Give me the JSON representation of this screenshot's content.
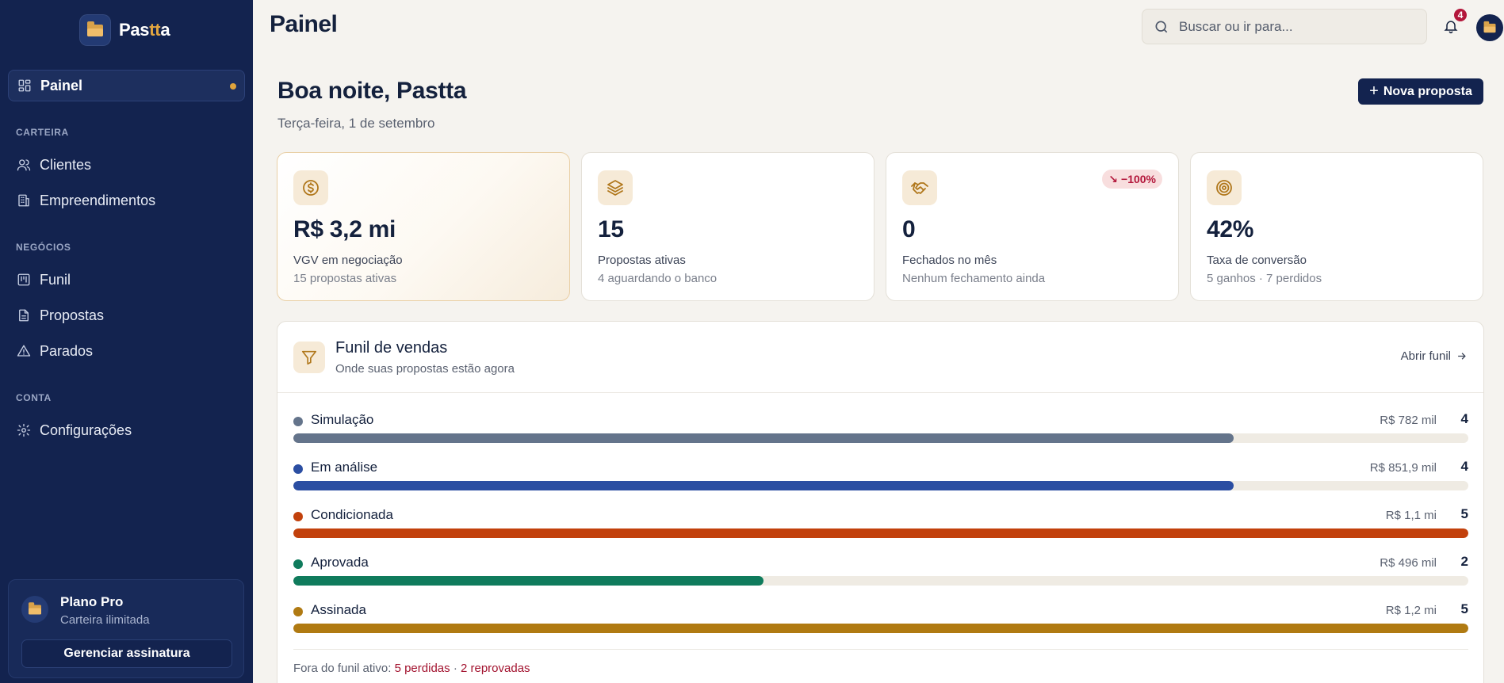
{
  "brand": {
    "prefix": "Pas",
    "accent": "tt",
    "suffix": "a"
  },
  "sidebar": {
    "active_item": {
      "label": "Painel",
      "icon": "grid-icon"
    },
    "sections": [
      {
        "title": "CARTEIRA",
        "items": [
          {
            "label": "Clientes",
            "icon": "users-icon"
          },
          {
            "label": "Empreendimentos",
            "icon": "building-icon"
          }
        ]
      },
      {
        "title": "NEGÓCIOS",
        "items": [
          {
            "label": "Funil",
            "icon": "kanban-icon"
          },
          {
            "label": "Propostas",
            "icon": "document-icon"
          },
          {
            "label": "Parados",
            "icon": "warning-icon"
          }
        ]
      },
      {
        "title": "CONTA",
        "items": [
          {
            "label": "Configurações",
            "icon": "gear-icon"
          }
        ]
      }
    ],
    "plan": {
      "title": "Plano Pro",
      "subtitle": "Carteira ilimitada",
      "button": "Gerenciar assinatura"
    }
  },
  "topbar": {
    "title": "Painel",
    "search_placeholder": "Buscar ou ir para...",
    "notification_count": "4"
  },
  "header": {
    "greeting": "Boa noite, Pastta",
    "date": "Terça-feira, 1 de setembro",
    "new_proposal_label": "Nova proposta"
  },
  "stats": [
    {
      "value": "R$ 3,2 mi",
      "label": "VGV em negociação",
      "sub": "15 propostas ativas",
      "icon": "dollar-circle-icon"
    },
    {
      "value": "15",
      "label": "Propostas ativas",
      "sub": "4 aguardando o banco",
      "icon": "layers-icon"
    },
    {
      "value": "0",
      "label": "Fechados no mês",
      "sub": "Nenhum fechamento ainda",
      "icon": "handshake-icon",
      "trend": "−100%"
    },
    {
      "value": "42%",
      "label": "Taxa de conversão",
      "sub": "5 ganhos · 7 perdidos",
      "icon": "target-icon"
    }
  ],
  "funnel": {
    "title": "Funil de vendas",
    "subtitle": "Onde suas propostas estão agora",
    "link_label": "Abrir funil",
    "stages": [
      {
        "name": "Simulação",
        "amount": "R$ 782 mil",
        "count": "4",
        "fill": 0.8,
        "color": "#64748b"
      },
      {
        "name": "Em análise",
        "amount": "R$ 851,9 mil",
        "count": "4",
        "fill": 0.8,
        "color": "#2b4ea2"
      },
      {
        "name": "Condicionada",
        "amount": "R$ 1,1 mi",
        "count": "5",
        "fill": 1.0,
        "color": "#c2410c"
      },
      {
        "name": "Aprovada",
        "amount": "R$ 496 mil",
        "count": "2",
        "fill": 0.4,
        "color": "#0f7b5c"
      },
      {
        "name": "Assinada",
        "amount": "R$ 1,2 mi",
        "count": "5",
        "fill": 1.0,
        "color": "#b07a12"
      }
    ],
    "footer_prefix": "Fora do funil ativo:",
    "lost_label": "5 perdidas",
    "separator": "·",
    "rejected_label": "2 reprovadas"
  }
}
